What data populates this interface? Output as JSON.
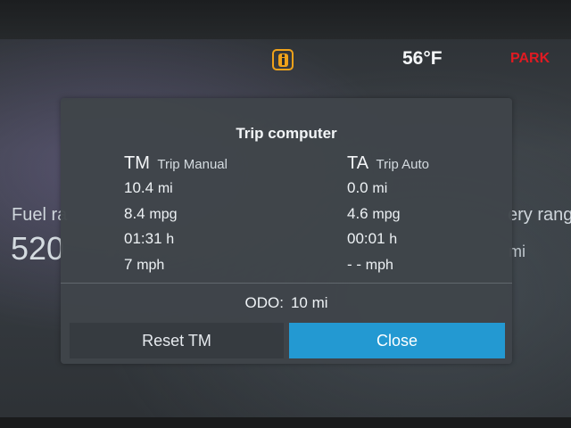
{
  "status_bar": {
    "info_icon": "info-icon",
    "temperature": "56°F",
    "gear": "PARK",
    "colors": {
      "info_accent": "#f0a21a",
      "gear": "#e01a22"
    }
  },
  "background": {
    "left_label": "Fuel ra",
    "left_value": "520",
    "right_label": "ery rang",
    "right_unit": "mi"
  },
  "trip_computer": {
    "title": "Trip computer",
    "tm": {
      "abbr": "TM",
      "name": "Trip Manual",
      "distance_value": "10.4",
      "distance_unit": "mi",
      "economy_value": "8.4",
      "economy_unit": "mpg",
      "time_value": "01:31",
      "time_unit": "h",
      "speed_value": "7",
      "speed_unit": "mph"
    },
    "ta": {
      "abbr": "TA",
      "name": "Trip Auto",
      "distance_value": "0.0",
      "distance_unit": "mi",
      "economy_value": "4.6",
      "economy_unit": "mpg",
      "time_value": "00:01",
      "time_unit": "h",
      "speed_value": "- -",
      "speed_unit": "mph"
    },
    "odo": {
      "label": "ODO:",
      "value": "10 mi"
    },
    "buttons": {
      "reset": "Reset TM",
      "close": "Close",
      "close_color": "#2399d2"
    }
  }
}
